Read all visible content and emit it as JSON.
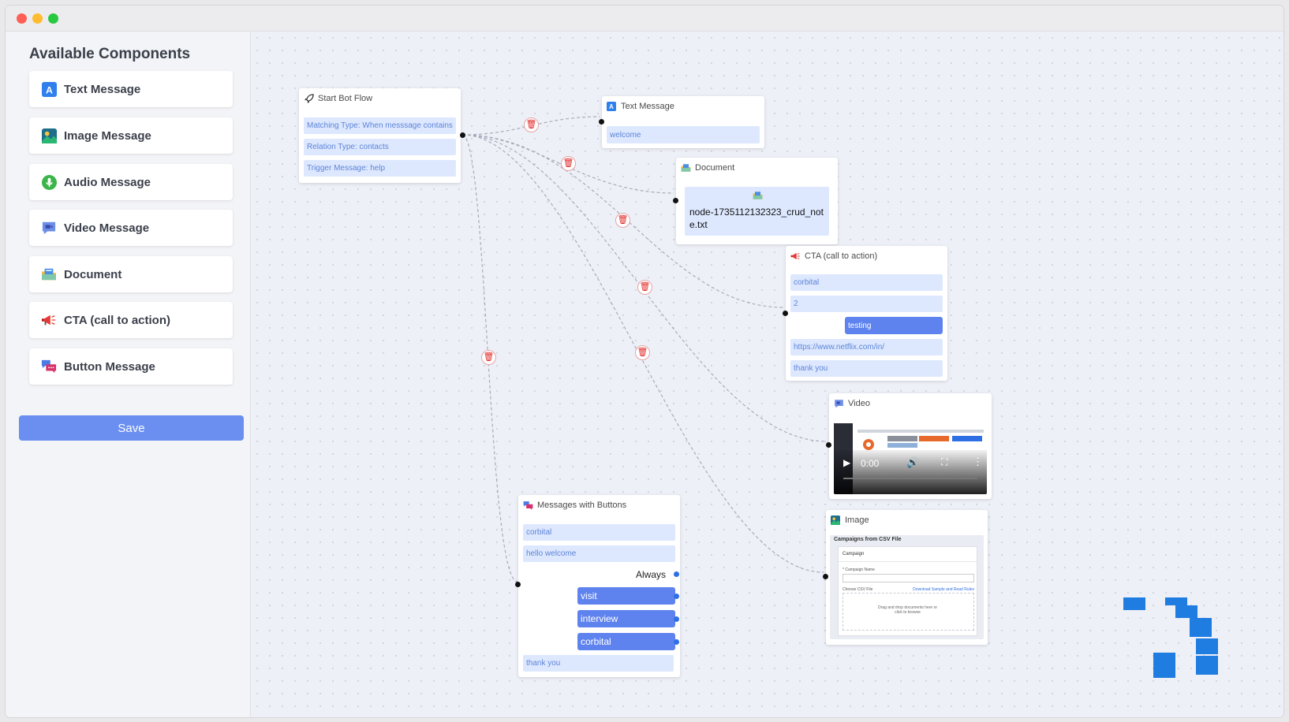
{
  "sidebar": {
    "title": "Available Components",
    "items": [
      {
        "label": "Text Message",
        "icon": "text-letter-icon"
      },
      {
        "label": "Image Message",
        "icon": "image-icon"
      },
      {
        "label": "Audio Message",
        "icon": "microphone-icon"
      },
      {
        "label": "Video Message",
        "icon": "video-camera-icon"
      },
      {
        "label": "Document",
        "icon": "document-icon"
      },
      {
        "label": "CTA (call to action)",
        "icon": "megaphone-icon"
      },
      {
        "label": "Button Message",
        "icon": "chat-bubbles-icon"
      }
    ],
    "save_label": "Save"
  },
  "nodes": {
    "start": {
      "title": "Start Bot Flow",
      "fields": [
        "Matching Type: When messsage contains",
        "Relation Type: contacts",
        "Trigger Message: help"
      ]
    },
    "text": {
      "title": "Text Message",
      "value": "welcome"
    },
    "document": {
      "title": "Document",
      "filename": "node-1735112132323_crud_note.txt"
    },
    "cta": {
      "title": "CTA (call to action)",
      "fields": [
        "corbital",
        "2"
      ],
      "button": "testing",
      "url": "https://www.netflix.com/in/",
      "footer": "thank you"
    },
    "video": {
      "title": "Video",
      "time": "0:00"
    },
    "image": {
      "title": "Image",
      "preview_heading": "Campaigns from CSV File",
      "preview_sub": "Campaign",
      "preview_field": "* Campaign Name",
      "preview_choose": "Choose CSV File",
      "preview_download": "Download Sample and Read Rules",
      "preview_drop": "Drag and drop documents here or click to browse"
    },
    "buttons": {
      "title": "Messages with Buttons",
      "header": "corbital",
      "body": "hello welcome",
      "always": "Always",
      "options": [
        "visit",
        "interview",
        "corbital"
      ],
      "footer": "thank you"
    }
  },
  "colors": {
    "accent": "#6a8ff0",
    "field_bg": "#dde8ff",
    "delete": "#e02626",
    "logo_blue": "#1f7ce0"
  }
}
